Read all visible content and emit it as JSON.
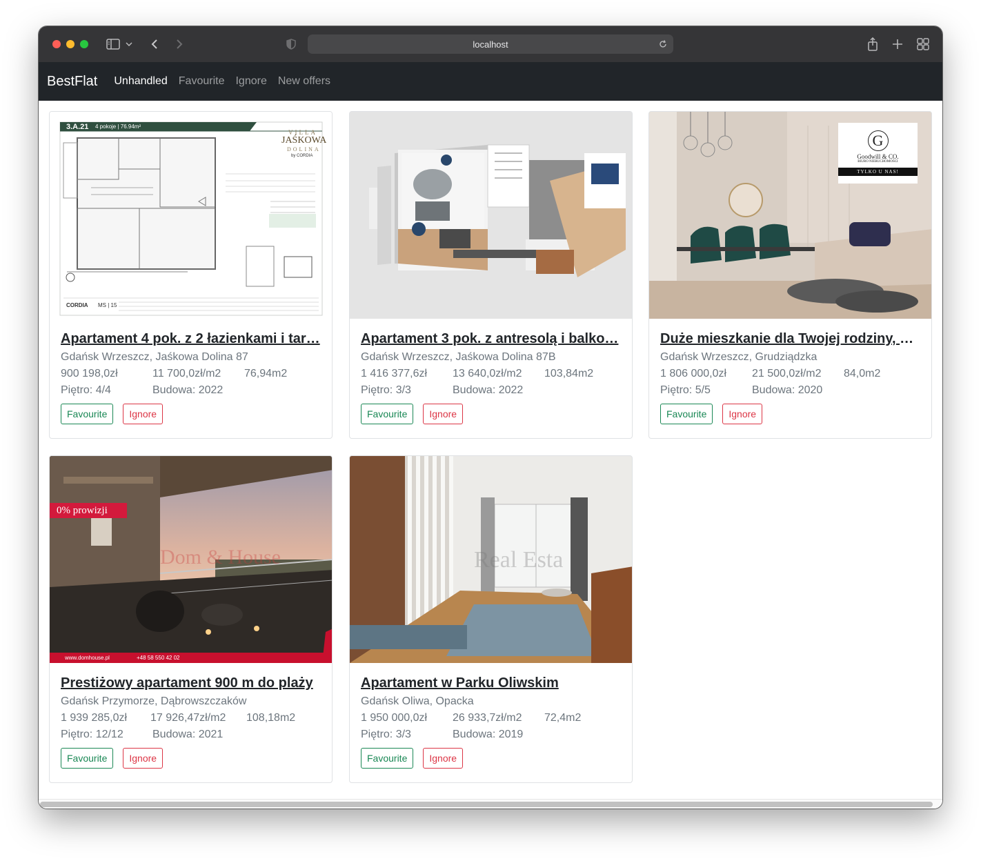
{
  "browser": {
    "url": "localhost",
    "colors": {
      "close": "#ff5f57",
      "minimize": "#febc2e",
      "zoom": "#28c840"
    }
  },
  "navbar": {
    "brand": "BestFlat",
    "links": [
      {
        "label": "Unhandled",
        "active": true
      },
      {
        "label": "Favourite",
        "active": false
      },
      {
        "label": "Ignore",
        "active": false
      },
      {
        "label": "New offers",
        "active": false
      }
    ]
  },
  "buttons": {
    "favourite": "Favourite",
    "ignore": "Ignore"
  },
  "cards": [
    {
      "title": "Apartament 4 pok. z 2 łazienkami i tar…",
      "location": "Gdańsk Wrzeszcz, Jaśkowa Dolina 87",
      "price": "900 198,0zł",
      "price_m2": "11 700,0zł/m2",
      "area": "76,94m2",
      "floor": "Piętro: 4/4",
      "built": "Budowa: 2022",
      "image": {
        "unit": "3.A.21",
        "rooms": "4 pokoje | 76.94m²",
        "brand_top": "VILLA",
        "brand_main": "JAŚKOWA",
        "brand_sub": "DOLINA",
        "brand_by": "by CORDIA",
        "footer_brand": "CORDIA",
        "footer_ms": "MS | 15"
      }
    },
    {
      "title": "Apartament 3 pok. z antresolą i balko…",
      "location": "Gdańsk Wrzeszcz, Jaśkowa Dolina 87B",
      "price": "1 416 377,6zł",
      "price_m2": "13 640,0zł/m2",
      "area": "103,84m2",
      "floor": "Piętro: 3/3",
      "built": "Budowa: 2022"
    },
    {
      "title": "Duże mieszkanie dla Twojej rodziny, bl…",
      "location": "Gdańsk Wrzeszcz, Grudziądzka",
      "price": "1 806 000,0zł",
      "price_m2": "21 500,0zł/m2",
      "area": "84,0m2",
      "floor": "Piętro: 5/5",
      "built": "Budowa: 2020",
      "image": {
        "logo_letter": "G",
        "logo_name": "Goodwill & CO.",
        "logo_sub": "BIURO NIERUCHOMOŚCI",
        "logo_tag": "TYLKO U NAS!"
      }
    },
    {
      "title": "Prestiżowy apartament 900 m do plaży",
      "location": "Gdańsk Przymorze, Dąbrowszczaków",
      "price": "1 939 285,0zł",
      "price_m2": "17 926,47zł/m2",
      "area": "108,18m2",
      "floor": "Piętro: 12/12",
      "built": "Budowa: 2021",
      "image": {
        "badge": "0% prowizji",
        "watermark": "Dom & House",
        "footer_site": "www.domhouse.pl",
        "footer_phone": "+48 58 550 42 02"
      }
    },
    {
      "title": "Apartament w Parku Oliwskim",
      "location": "Gdańsk Oliwa, Opacka",
      "price": "1 950 000,0zł",
      "price_m2": "26 933,7zł/m2",
      "area": "72,4m2",
      "floor": "Piętro: 3/3",
      "built": "Budowa: 2019",
      "image": {
        "watermark": "Real Esta"
      }
    }
  ]
}
